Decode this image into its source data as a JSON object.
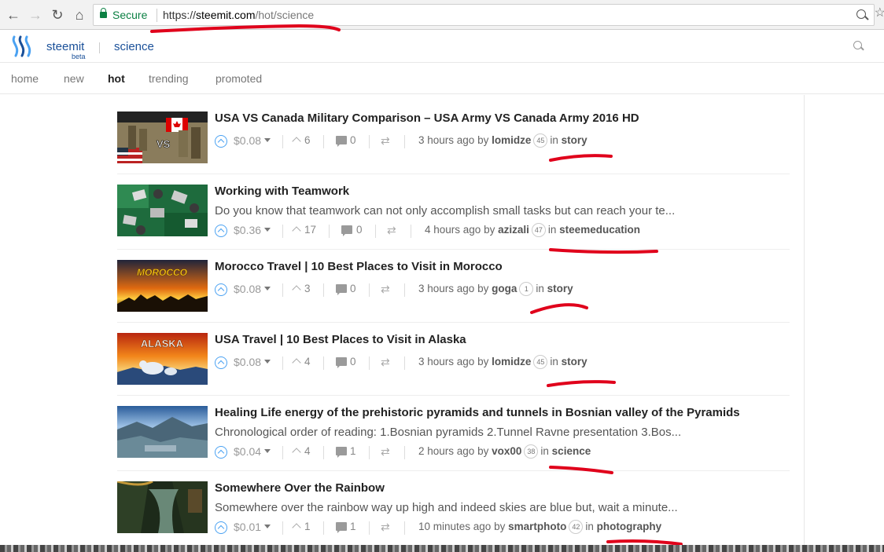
{
  "browser": {
    "secure_label": "Secure",
    "url_scheme": "https://",
    "url_host": "steemit.com",
    "url_path": "/hot/science"
  },
  "header": {
    "brand": "steemit",
    "beta": "beta",
    "topic": "science"
  },
  "tabs": [
    {
      "label": "home"
    },
    {
      "label": "new"
    },
    {
      "label": "hot",
      "active": true
    },
    {
      "label": "trending"
    },
    {
      "label": "promoted"
    }
  ],
  "posts": [
    {
      "title": "USA VS Canada Military Comparison – USA Army VS Canada Army 2016 HD",
      "excerpt": "",
      "payout": "$0.08",
      "votes": "6",
      "comments": "0",
      "time": "3 hours ago",
      "by": "by",
      "author": "lomidze",
      "reputation": "45",
      "in": "in",
      "community": "story"
    },
    {
      "title": "Working with Teamwork",
      "excerpt": "Do you know that teamwork can not only accomplish small tasks but can reach your te...",
      "payout": "$0.36",
      "votes": "17",
      "comments": "0",
      "time": "4 hours ago",
      "by": "by",
      "author": "azizali",
      "reputation": "47",
      "in": "in",
      "community": "steemeducation"
    },
    {
      "title": "Morocco Travel | 10 Best Places to Visit in Morocco",
      "excerpt": "",
      "payout": "$0.08",
      "votes": "3",
      "comments": "0",
      "time": "3 hours ago",
      "by": "by",
      "author": "goga",
      "reputation": "1",
      "in": "in",
      "community": "story",
      "thumb_text": "MOROCCO"
    },
    {
      "title": "USA Travel | 10 Best Places to Visit in Alaska",
      "excerpt": "",
      "payout": "$0.08",
      "votes": "4",
      "comments": "0",
      "time": "3 hours ago",
      "by": "by",
      "author": "lomidze",
      "reputation": "45",
      "in": "in",
      "community": "story",
      "thumb_text": "ALASKA"
    },
    {
      "title": "Healing Life energy of the prehistoric pyramids and tunnels in Bosnian valley of the Pyramids",
      "excerpt": "Chronological order of reading: 1.Bosnian pyramids 2.Tunnel Ravne presentation 3.Bos...",
      "payout": "$0.04",
      "votes": "4",
      "comments": "1",
      "time": "2 hours ago",
      "by": "by",
      "author": "vox00",
      "reputation": "38",
      "in": "in",
      "community": "science"
    },
    {
      "title": "Somewhere Over the Rainbow",
      "excerpt": "Somewhere over the rainbow way up high and indeed skies are blue but, wait a minute...",
      "payout": "$0.01",
      "votes": "1",
      "comments": "1",
      "time": "10 minutes ago",
      "by": "by",
      "author": "smartphoto",
      "reputation": "42",
      "in": "in",
      "community": "photography"
    }
  ],
  "thumb_vs_text": "VS",
  "colors": {
    "brand": "#1a5099",
    "upvote": "#4ba2f2",
    "annotation": "#e0001b",
    "secure": "#0b8043"
  }
}
